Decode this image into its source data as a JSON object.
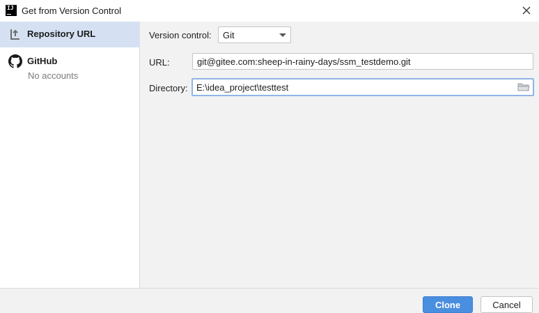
{
  "window": {
    "title": "Get from Version Control",
    "app_icon": "intellij-idea-icon",
    "close_icon": "close-icon"
  },
  "sidebar": {
    "items": [
      {
        "label": "Repository URL",
        "icon": "repository-url-icon",
        "selected": true
      },
      {
        "label": "GitHub",
        "sublabel": "No accounts",
        "icon": "github-icon",
        "selected": false
      }
    ]
  },
  "form": {
    "version_control_label": "Version control:",
    "version_control_value": "Git",
    "url_label": "URL:",
    "url_value": "git@gitee.com:sheep-in-rainy-days/ssm_testdemo.git",
    "directory_label": "Directory:",
    "directory_value": "E:\\idea_project\\testtest",
    "browse_icon": "folder-icon"
  },
  "footer": {
    "clone_label": "Clone",
    "cancel_label": "Cancel"
  },
  "colors": {
    "accent": "#4a8ee0",
    "selection": "#d5e1f2",
    "focus_border": "#8fb5e7"
  }
}
